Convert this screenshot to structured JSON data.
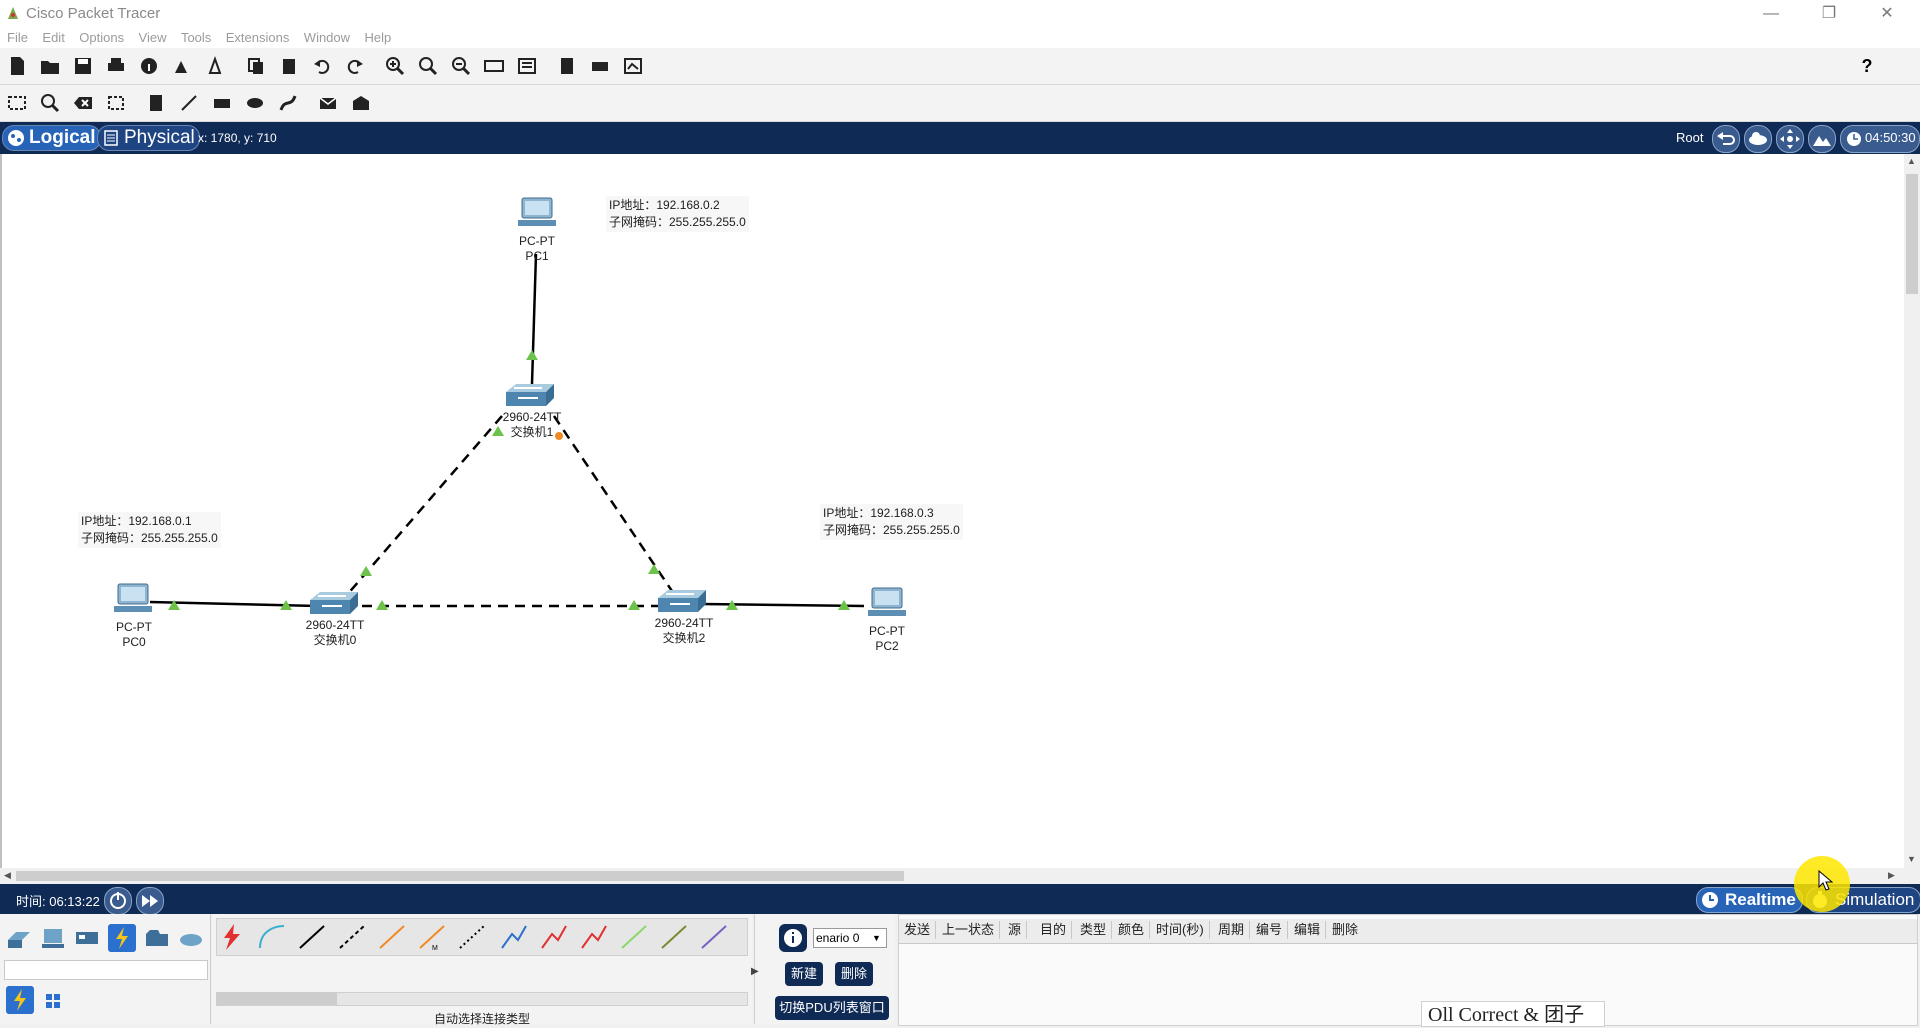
{
  "window": {
    "title": "Cisco Packet Tracer",
    "minimize": "—",
    "restore": "❐",
    "close": "✕"
  },
  "menu": [
    "File",
    "Edit",
    "Options",
    "View",
    "Tools",
    "Extensions",
    "Window",
    "Help"
  ],
  "help_icon": "?",
  "view_tabs": {
    "logical": "Logical",
    "physical": "Physical"
  },
  "coords": "x: 1780, y: 710",
  "root_label": "Root",
  "clock": "04:50:30",
  "devices": [
    {
      "id": "pc1",
      "type": "PC-PT",
      "name": "PC1"
    },
    {
      "id": "sw1",
      "type": "2960-24TT",
      "name": "交换机1"
    },
    {
      "id": "pc0",
      "type": "PC-PT",
      "name": "PC0"
    },
    {
      "id": "sw0",
      "type": "2960-24TT",
      "name": "交换机0"
    },
    {
      "id": "sw2",
      "type": "2960-24TT",
      "name": "交换机2"
    },
    {
      "id": "pc2",
      "type": "PC-PT",
      "name": "PC2"
    }
  ],
  "notes": [
    {
      "ip": "IP地址：192.168.0.2",
      "mask": "子网掩码：255.255.255.0"
    },
    {
      "ip": "IP地址：192.168.0.1",
      "mask": "子网掩码：255.255.255.0"
    },
    {
      "ip": "IP地址：192.168.0.3",
      "mask": "子网掩码：255.255.255.0"
    }
  ],
  "status": {
    "time": "时间: 06:13:22",
    "realtime": "Realtime",
    "simulation": "Simulation"
  },
  "bottom": {
    "auto_connect": "自动选择连接类型",
    "scenario": "enario 0",
    "new_btn": "新建",
    "delete_btn": "删除",
    "toggle_pdu": "切换PDU列表窗口",
    "pdu_columns": [
      "发送",
      "上一状态",
      "源",
      "目的",
      "类型",
      "颜色",
      "时间(秒)",
      "周期",
      "编号",
      "编辑",
      "删除"
    ],
    "watermark": "Oll Correct & 团子"
  },
  "colors": {
    "accent": "#0f2a55",
    "link_up": "#5cb85c",
    "link_pending": "#f08a24"
  }
}
